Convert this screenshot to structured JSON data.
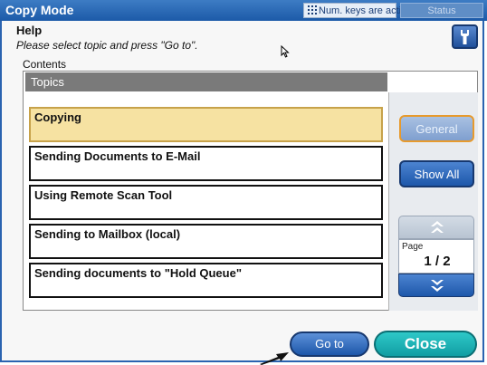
{
  "window": {
    "title": "Copy Mode",
    "num_keys_message": "Num. keys are active.",
    "status_label": "Status"
  },
  "help": {
    "label": "Help",
    "message": "Please select topic and press \"Go to\"."
  },
  "contents": {
    "label": "Contents",
    "topics_header": "Topics",
    "topics": [
      {
        "label": "Copying",
        "selected": true
      },
      {
        "label": "Sending Documents to E-Mail",
        "selected": false
      },
      {
        "label": "Using Remote Scan Tool",
        "selected": false
      },
      {
        "label": "Sending to Mailbox (local)",
        "selected": false
      },
      {
        "label": "Sending documents to \"Hold Queue\"",
        "selected": false
      }
    ]
  },
  "side_buttons": {
    "general": "General",
    "show_all": "Show All"
  },
  "pager": {
    "label": "Page",
    "value": "1 / 2"
  },
  "actions": {
    "go_to": "Go to",
    "close": "Close"
  },
  "colors": {
    "accent_blue": "#1d57aa",
    "selected_topic_bg": "#f6e2a2",
    "close_teal": "#119ea3",
    "general_border_orange": "#e79a2d"
  },
  "icons": {
    "help_tool": "wrench-icon",
    "page_up": "double-chevron-up-icon",
    "page_down": "double-chevron-down-icon",
    "num_keys": "keypad-icon"
  }
}
